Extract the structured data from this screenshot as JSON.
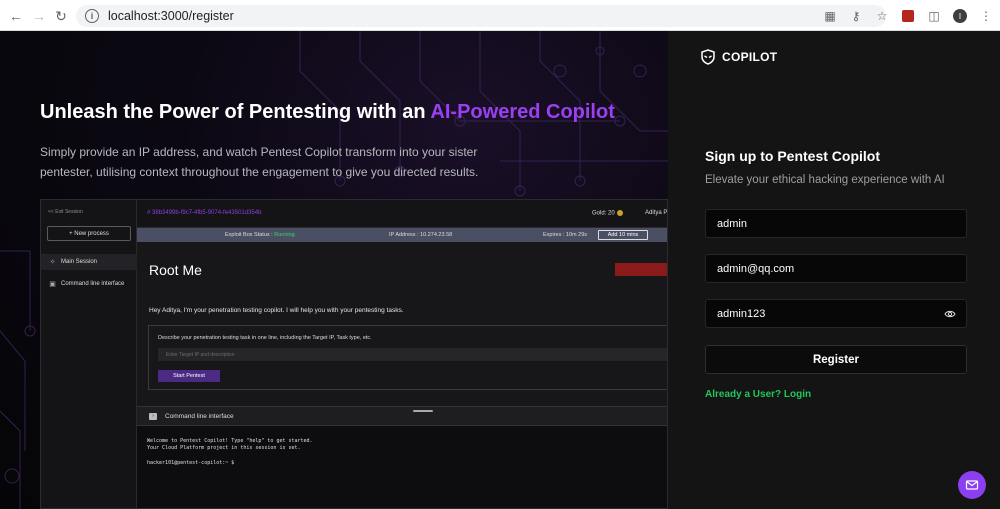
{
  "browser": {
    "url": "localhost:3000/register",
    "profile_initial": "I"
  },
  "hero": {
    "title_main": "Unleash the Power of Pentesting with an ",
    "title_accent": "AI-Powered Copilot",
    "subtitle": "Simply provide an IP address, and watch Pentest Copilot transform into your sister pentester, utilising context throughout the engagement to give you directed results."
  },
  "app_preview": {
    "exit_session": "<< Exit Session",
    "new_process": "+ New process",
    "sidebar": [
      {
        "label": "Main Session",
        "icon": "sparkle-icon"
      },
      {
        "label": "Command line interface",
        "icon": "terminal-icon"
      }
    ],
    "session_id": "# 38b3499b-f9c7-4fb5-9074-fe43501d354b",
    "gold": "Gold: 20",
    "user": "Aditya P",
    "status": {
      "exploit_label": "Exploit Box Status :",
      "exploit_value": "Running",
      "ip": "IP Address : 10.274.23.58",
      "expires": "Expires : 10m 29s",
      "add_button": "Add 10 mins"
    },
    "heading": "Root Me",
    "greeting": "Hey Aditya, I'm your penetration testing copilot. I will help you with your pentesting tasks.",
    "task_label": "Describe your penetration testing task in one line, including the Target IP, Task type, etc.",
    "task_placeholder": "Enter Target IP and description",
    "start_button": "Start Pentest",
    "cli_title": "Command line interface",
    "cli_lines": [
      "Welcome to Pentest Copilot! Type \"help\" to get started.",
      "Your Cloud Platform project in this session is set.",
      "hacker101@pentest-copilot:~ $"
    ]
  },
  "panel": {
    "brand": "COPILOT",
    "title": "Sign up to Pentest Copilot",
    "subtitle": "Elevate your ethical hacking experience with AI",
    "username_value": "admin",
    "email_value": "admin@qq.com",
    "password_value": "admin123",
    "register_label": "Register",
    "login_link": "Already a User? Login"
  },
  "colors": {
    "accent": "#9b3ff0",
    "link": "#22c55e",
    "danger": "#8b1a1a"
  }
}
